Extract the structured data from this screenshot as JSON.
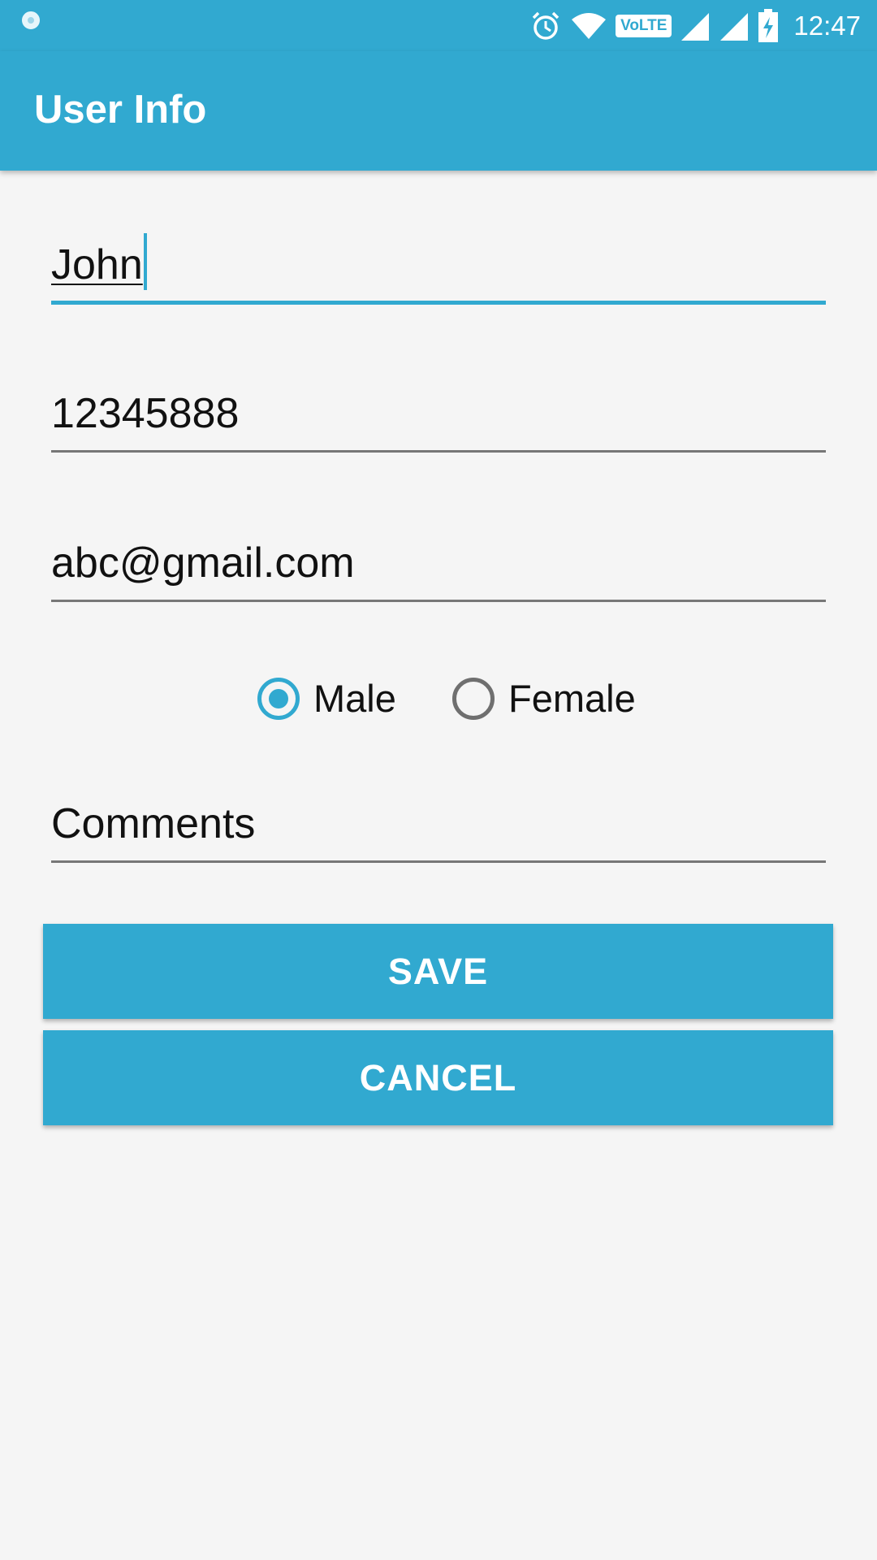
{
  "status_bar": {
    "time": "12:47",
    "volte": "VoLTE",
    "icons": [
      "notification-dot-icon",
      "alarm-icon",
      "wifi-icon",
      "volte-icon",
      "signal-icon",
      "signal-icon",
      "battery-charging-icon"
    ]
  },
  "app_bar": {
    "title": "User Info"
  },
  "form": {
    "name_value": "John",
    "phone_value": "12345888",
    "email_value": "abc@gmail.com",
    "gender": {
      "male_label": "Male",
      "female_label": "Female",
      "selected": "Male"
    },
    "comments_value": "Comments"
  },
  "buttons": {
    "save_label": "SAVE",
    "cancel_label": "CANCEL"
  },
  "colors": {
    "accent": "#31a9d0",
    "background": "#f5f5f5"
  }
}
